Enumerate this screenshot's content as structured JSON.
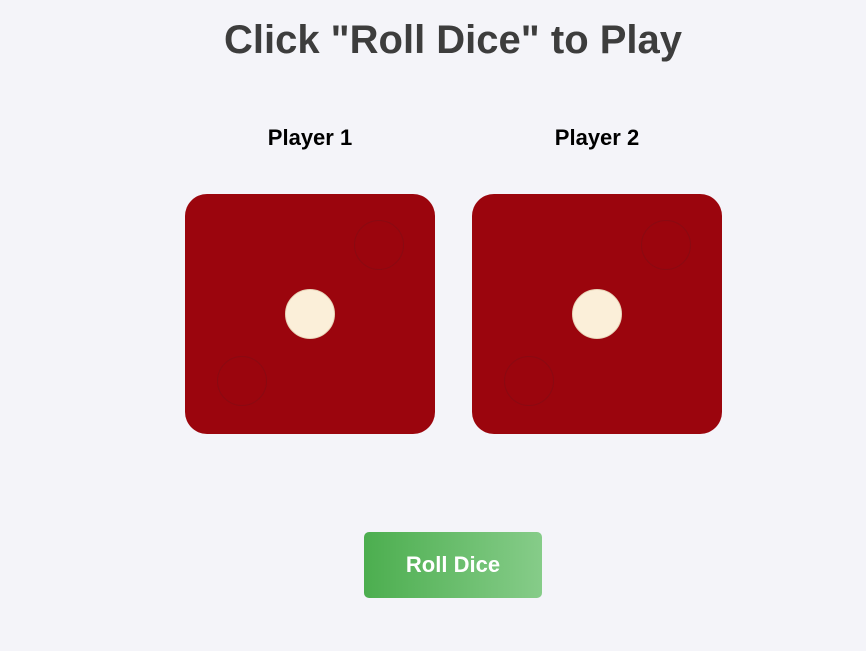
{
  "title": "Click \"Roll Dice\" to Play",
  "players": [
    {
      "label": "Player 1",
      "die_value": 1
    },
    {
      "label": "Player 2",
      "die_value": 1
    }
  ],
  "roll_button": {
    "label": "Roll Dice"
  },
  "colors": {
    "background": "#f4f4f9",
    "die": "#9b050d",
    "pip": "#fbefd9",
    "button_start": "#4cae4f",
    "button_end": "#86cc89",
    "title": "#3d3d3d"
  }
}
